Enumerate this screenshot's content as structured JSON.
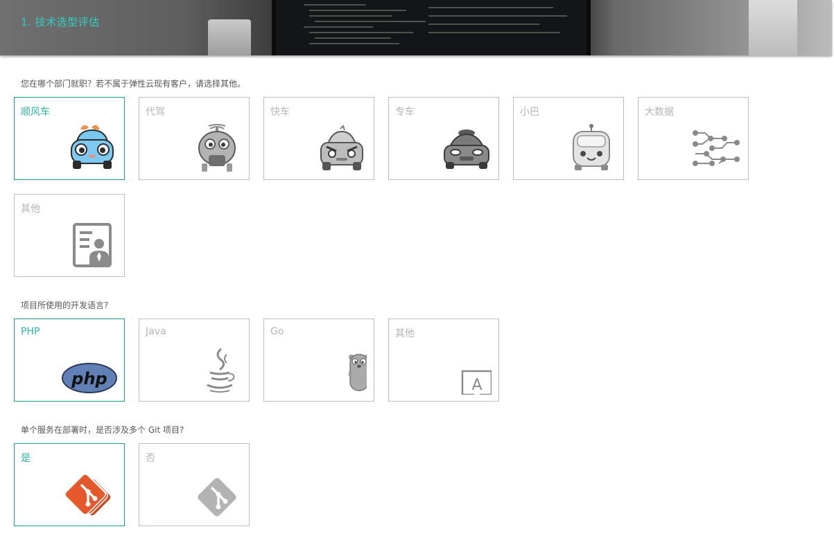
{
  "header": {
    "title": "1. 技术选型评估"
  },
  "q1": {
    "text": "您在哪个部门就职？若不属于弹性云现有客户，请选择其他。",
    "options": [
      {
        "label": "顺风车",
        "icon": "cute-car-icon",
        "selected": true
      },
      {
        "label": "代驾",
        "icon": "helicopter-robot-icon",
        "selected": false
      },
      {
        "label": "快车",
        "icon": "angry-car-icon",
        "selected": false
      },
      {
        "label": "专车",
        "icon": "luxury-car-icon",
        "selected": false
      },
      {
        "label": "小巴",
        "icon": "minibus-icon",
        "selected": false
      },
      {
        "label": "大数据",
        "icon": "circuit-icon",
        "selected": false
      },
      {
        "label": "其他",
        "icon": "person-document-icon",
        "selected": false
      }
    ]
  },
  "q2": {
    "text": "项目所使用的开发语言?",
    "options": [
      {
        "label": "PHP",
        "icon": "php-logo-icon",
        "selected": true
      },
      {
        "label": "Java",
        "icon": "java-cup-icon",
        "selected": false
      },
      {
        "label": "Go",
        "icon": "gopher-icon",
        "selected": false
      },
      {
        "label": "其他",
        "icon": "letter-a-bubble-icon",
        "selected": false
      }
    ]
  },
  "q3": {
    "text": "单个服务在部署时，是否涉及多个 Git 项目?",
    "options": [
      {
        "label": "是",
        "icon": "git-stack-icon",
        "selected": true
      },
      {
        "label": "否",
        "icon": "git-icon",
        "selected": false
      }
    ]
  },
  "colors": {
    "accent": "#1a9b8d",
    "accent_text": "#2bb3a6",
    "header_title": "#2fd0c1",
    "git_orange": "#e4582b",
    "php_blue": "#6181b6"
  }
}
